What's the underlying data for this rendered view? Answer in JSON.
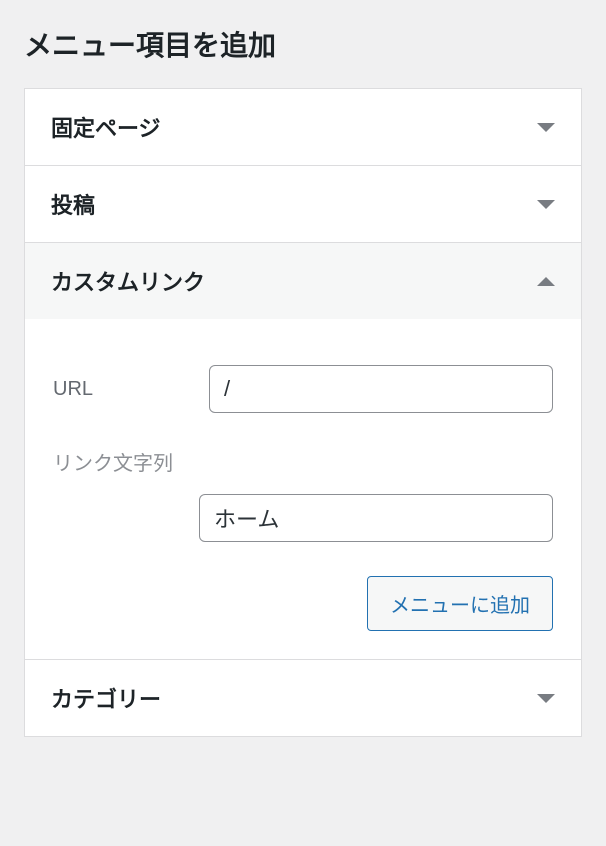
{
  "title": "メニュー項目を追加",
  "sections": {
    "pages": {
      "label": "固定ページ"
    },
    "posts": {
      "label": "投稿"
    },
    "custom_link": {
      "label": "カスタムリンク",
      "url_label": "URL",
      "url_value": "/",
      "link_text_label": "リンク文字列",
      "link_text_value": "ホーム",
      "add_button": "メニューに追加"
    },
    "categories": {
      "label": "カテゴリー"
    }
  }
}
